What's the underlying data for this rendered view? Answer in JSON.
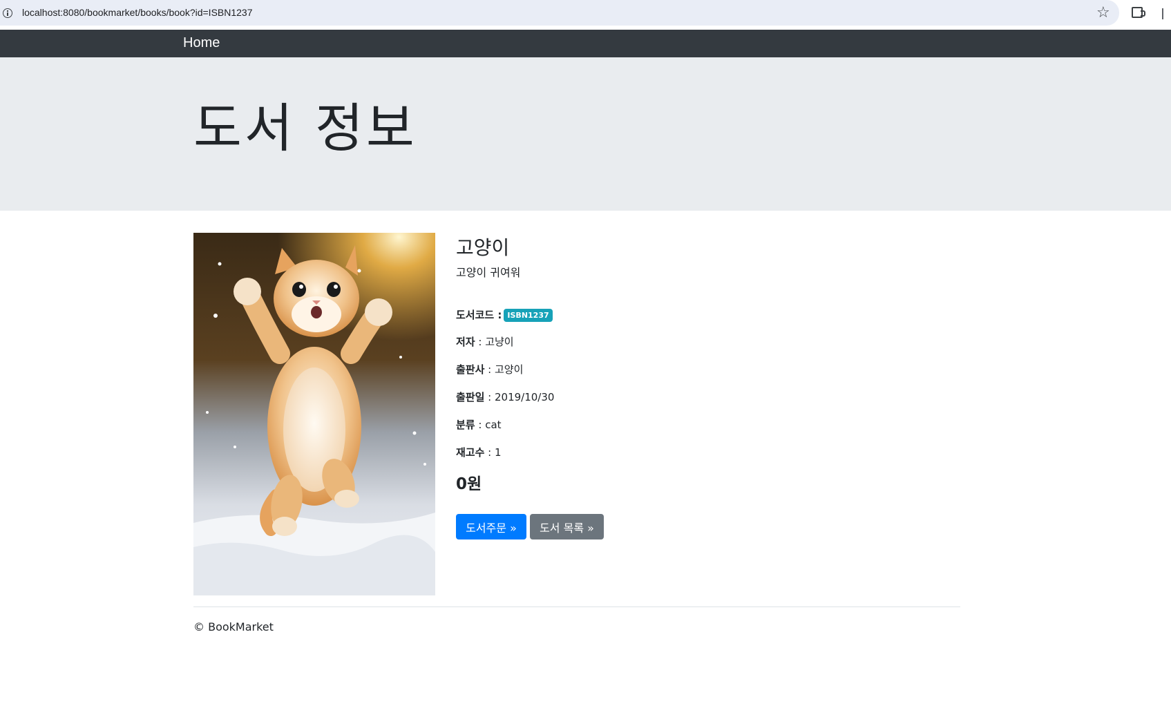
{
  "browser": {
    "url": "localhost:8080/bookmarket/books/book?id=ISBN1237"
  },
  "navbar": {
    "home_label": "Home"
  },
  "jumbotron": {
    "title": "도서 정보"
  },
  "book": {
    "name": "고양이",
    "description": "고양이 귀여워",
    "code_label": "도서코드 :",
    "code_value": "ISBN1237",
    "author_label": "저자",
    "author_value": " : 고냥이",
    "publisher_label": "출판사",
    "publisher_value": " : 고양이",
    "release_label": "출판일",
    "release_value": " : 2019/10/30",
    "category_label": "분류",
    "category_value": " : cat",
    "stock_label": "재고수",
    "stock_value": " : 1",
    "price": "0원"
  },
  "buttons": {
    "order_label": "도서주문 »",
    "list_label": "도서 목록 »"
  },
  "footer": {
    "text": "© BookMarket"
  },
  "colors": {
    "navbar": "#343a40",
    "jumbotron": "#e9ecef",
    "primary": "#007bff",
    "secondary": "#6c757d",
    "badge": "#17a2b8"
  }
}
